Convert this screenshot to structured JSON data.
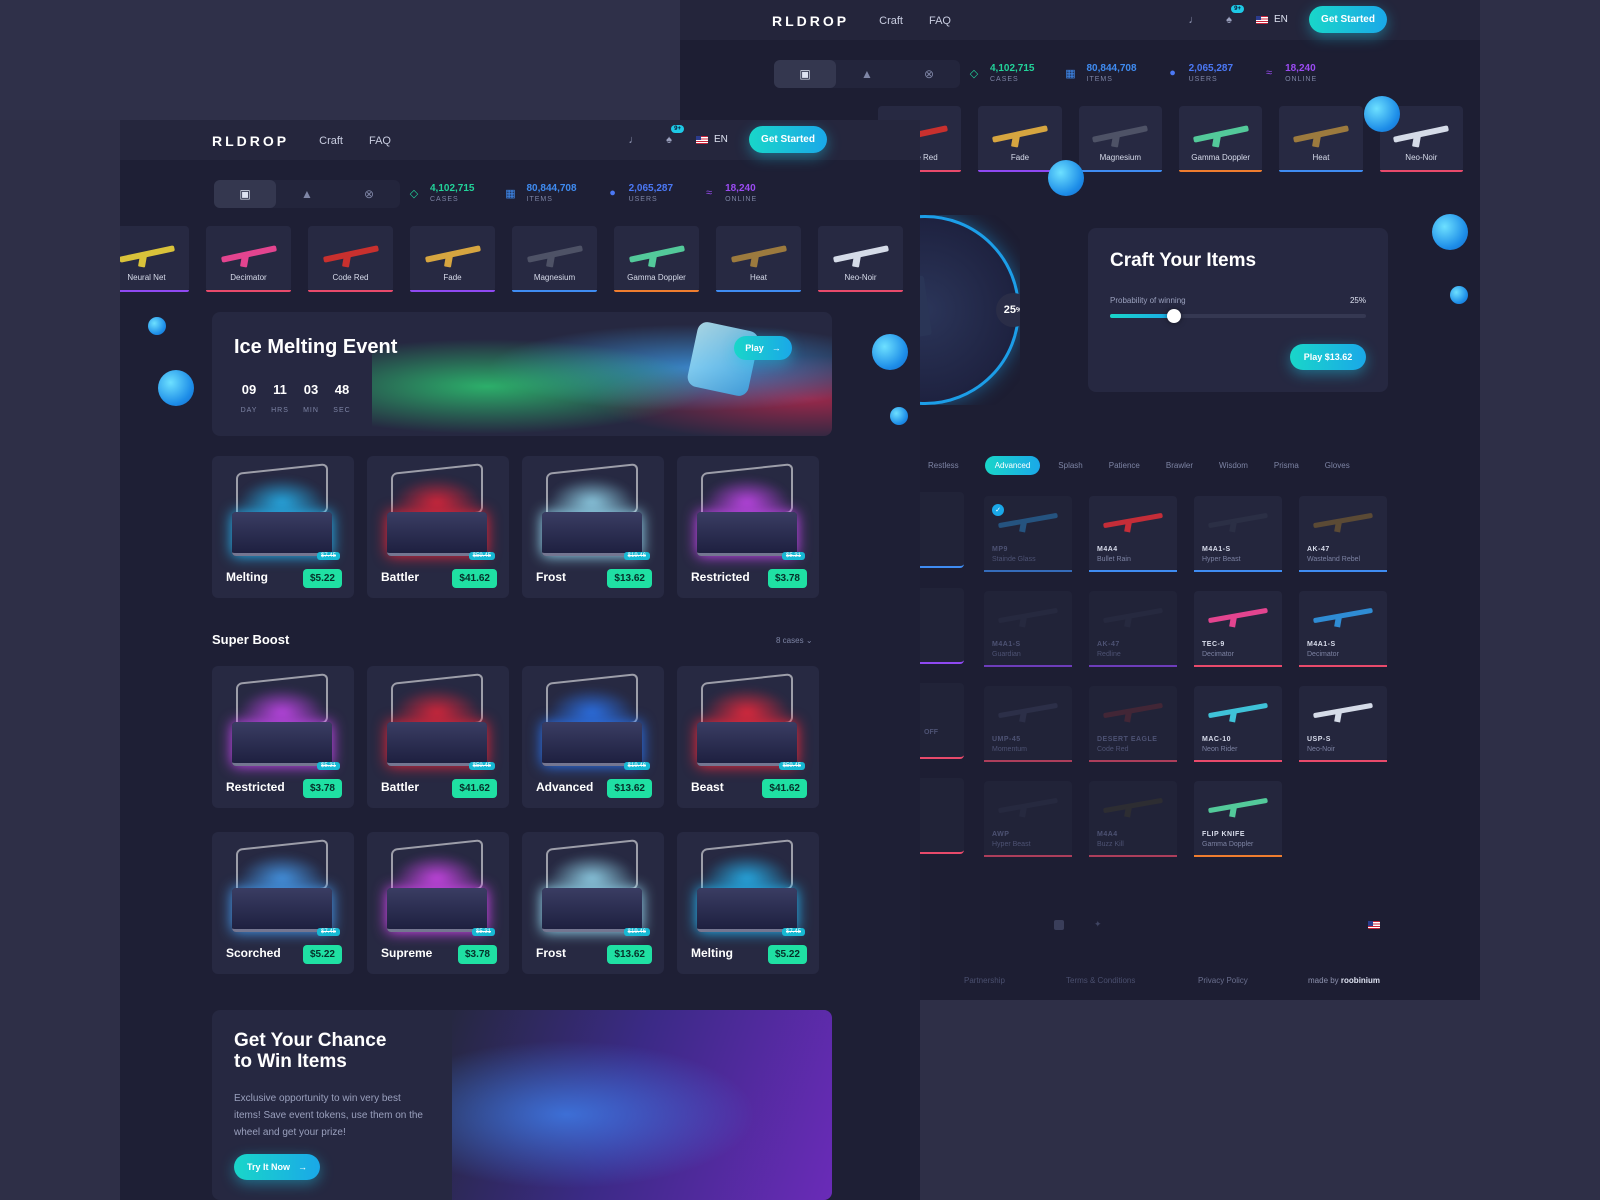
{
  "app": {
    "logo": "RLDROP"
  },
  "nav": {
    "craft": "Craft",
    "faq": "FAQ",
    "notif_badge": "9+",
    "lang": "EN",
    "cta": "Get Started"
  },
  "stats": [
    {
      "value": "4,102,715",
      "label": "CASES",
      "color": "#22d39a"
    },
    {
      "value": "80,844,708",
      "label": "ITEMS",
      "color": "#3f8cf2"
    },
    {
      "value": "2,065,287",
      "label": "USERS",
      "color": "#4b78f5"
    },
    {
      "value": "18,240",
      "label": "ONLINE",
      "color": "#9a4bf2"
    }
  ],
  "ticker_left": [
    {
      "name": "Neural Net",
      "color": "#d9c23a",
      "bar": "#8f49f2"
    },
    {
      "name": "Decimator",
      "color": "#e3448f",
      "bar": "#e84a6b"
    },
    {
      "name": "Code Red",
      "color": "#c8302e",
      "bar": "#e84a6b"
    },
    {
      "name": "Fade",
      "color": "#d6a540",
      "bar": "#8f49f2"
    },
    {
      "name": "Magnesium",
      "color": "#4e5266",
      "bar": "#3f8cf2"
    },
    {
      "name": "Gamma Doppler",
      "color": "#53c99a",
      "bar": "#ef7d2f"
    },
    {
      "name": "Heat",
      "color": "#9c7a3e",
      "bar": "#3f8cf2"
    },
    {
      "name": "Neo-Noir",
      "color": "#d5dbe8",
      "bar": "#e84a6b"
    }
  ],
  "ticker_right": [
    {
      "name": "Code Red",
      "color": "#c8302e",
      "bar": "#e84a6b"
    },
    {
      "name": "Fade",
      "color": "#d6a540",
      "bar": "#8f49f2"
    },
    {
      "name": "Magnesium",
      "color": "#4e5266",
      "bar": "#3f8cf2"
    },
    {
      "name": "Gamma Doppler",
      "color": "#53c99a",
      "bar": "#ef7d2f"
    },
    {
      "name": "Heat",
      "color": "#9c7a3e",
      "bar": "#3f8cf2"
    },
    {
      "name": "Neo-Noir",
      "color": "#d5dbe8",
      "bar": "#e84a6b"
    }
  ],
  "event": {
    "title": "Ice Melting Event",
    "play": "Play",
    "countdown": [
      {
        "value": "09",
        "unit": "DAY"
      },
      {
        "value": "11",
        "unit": "HRS"
      },
      {
        "value": "03",
        "unit": "MIN"
      },
      {
        "value": "48",
        "unit": "SEC"
      }
    ]
  },
  "cases_top": [
    {
      "name": "Melting",
      "price": "$5.22",
      "old": "$7.45",
      "glow": "#27c0ff"
    },
    {
      "name": "Battler",
      "price": "$41.62",
      "old": "$59.45",
      "glow": "#f0263a"
    },
    {
      "name": "Frost",
      "price": "$13.62",
      "old": "$19.46",
      "glow": "#9fe8ff"
    },
    {
      "name": "Restricted",
      "price": "$3.78",
      "old": "$5.31",
      "glow": "#d54bff"
    }
  ],
  "super_boost": {
    "title": "Super Boost",
    "filter": "8 cases"
  },
  "cases_boost_1": [
    {
      "name": "Restricted",
      "price": "$3.78",
      "old": "$5.31",
      "glow": "#d54bff"
    },
    {
      "name": "Battler",
      "price": "$41.62",
      "old": "$59.45",
      "glow": "#f0263a"
    },
    {
      "name": "Advanced",
      "price": "$13.62",
      "old": "$19.46",
      "glow": "#2d7cff"
    },
    {
      "name": "Beast",
      "price": "$41.62",
      "old": "$59.45",
      "glow": "#ff2a3c"
    }
  ],
  "cases_boost_2": [
    {
      "name": "Scorched",
      "price": "$5.22",
      "old": "$7.45",
      "glow": "#4aa7ff"
    },
    {
      "name": "Supreme",
      "price": "$3.78",
      "old": "$5.31",
      "glow": "#e24bff"
    },
    {
      "name": "Frost",
      "price": "$13.62",
      "old": "$19.46",
      "glow": "#9fe8ff"
    },
    {
      "name": "Melting",
      "price": "$5.22",
      "old": "$7.45",
      "glow": "#27c0ff"
    }
  ],
  "promo": {
    "title_line1": "Get Your Chance",
    "title_line2": "to Win Items",
    "body": "Exclusive opportunity to win very best items! Save event tokens, use them on the wheel and get your prize!",
    "cta": "Try It Now"
  },
  "craft": {
    "title": "Craft Your Items",
    "prob_label": "Probability of winning",
    "prob_value": "25%",
    "probability": 0.25,
    "dial_value": "25",
    "dial_unit": "%",
    "play": "Play $13.62"
  },
  "categories": [
    {
      "label": "Restless",
      "active": false
    },
    {
      "label": "Advanced",
      "active": true
    },
    {
      "label": "Splash",
      "active": false
    },
    {
      "label": "Patience",
      "active": false
    },
    {
      "label": "Brawler",
      "active": false
    },
    {
      "label": "Wisdom",
      "active": false
    },
    {
      "label": "Prisma",
      "active": false
    },
    {
      "label": "Gloves",
      "active": false
    }
  ],
  "skins": [
    [
      {
        "name": "MP9",
        "skin": "Stainde Glass",
        "color": "#2a8fd6",
        "bar": "#3f8cf2",
        "dim": true,
        "checked": true
      },
      {
        "name": "M4A4",
        "skin": "Bullet Rain",
        "color": "#c42d38",
        "bar": "#3f8cf2",
        "dim": false
      },
      {
        "name": "M4A1-S",
        "skin": "Hyper Beast",
        "color": "#2b2f45",
        "bar": "#3f8cf2",
        "dim": false
      },
      {
        "name": "AK-47",
        "skin": "Wasteland Rebel",
        "color": "#5b4a35",
        "bar": "#3f8cf2",
        "dim": false
      }
    ],
    [
      {
        "name": "M4A1-S",
        "skin": "Guardian",
        "color": "#2e3248",
        "bar": "#8f49f2",
        "dim": true
      },
      {
        "name": "AK-47",
        "skin": "Redline",
        "color": "#2e3248",
        "bar": "#8f49f2",
        "dim": true
      },
      {
        "name": "TEC-9",
        "skin": "Decimator",
        "color": "#e3448f",
        "bar": "#e84a6b",
        "dim": false
      },
      {
        "name": "M4A1-S",
        "skin": "Decimator",
        "color": "#2f8cd4",
        "bar": "#e84a6b",
        "dim": false
      }
    ],
    [
      {
        "name": "UMP-45",
        "skin": "Momentum",
        "color": "#3a3f5c",
        "bar": "#e84a6b",
        "dim": true
      },
      {
        "name": "DESERT EAGLE",
        "skin": "Code Red",
        "color": "#6a2a34",
        "bar": "#e84a6b",
        "dim": true
      },
      {
        "name": "MAC-10",
        "skin": "Neon Rider",
        "color": "#3fc2d8",
        "bar": "#e84a6b",
        "dim": false
      },
      {
        "name": "USP-S",
        "skin": "Neo-Noir",
        "color": "#d5dbe8",
        "bar": "#e84a6b",
        "dim": false
      }
    ],
    [
      {
        "name": "AWP",
        "skin": "Hyper Beast",
        "color": "#2e3248",
        "bar": "#e84a6b",
        "dim": true
      },
      {
        "name": "M4A4",
        "skin": "Buzz Kill",
        "color": "#3d3a2c",
        "bar": "#e84a6b",
        "dim": true
      },
      {
        "name": "FLIP KNIFE",
        "skin": "Gamma Doppler",
        "color": "#53c99a",
        "bar": "#ef7d2f",
        "dim": false
      }
    ]
  ],
  "partial_labels": [
    "OFF"
  ],
  "footer": {
    "partnership": "Partnership",
    "terms": "Terms & Conditions",
    "privacy": "Privacy Policy",
    "made_by": "made by",
    "author": "roobinium"
  }
}
